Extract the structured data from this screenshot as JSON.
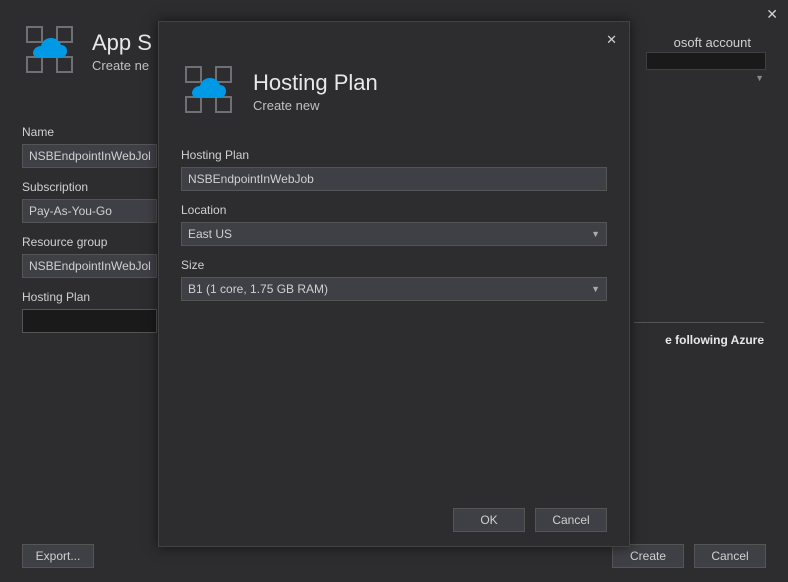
{
  "bg": {
    "title": "App S",
    "subtitle": "Create ne",
    "account_label": "osoft account",
    "fields": {
      "name_label": "Name",
      "name_value": "NSBEndpointInWebJob",
      "subscription_label": "Subscription",
      "subscription_value": "Pay-As-You-Go",
      "resource_group_label": "Resource group",
      "resource_group_value": "NSBEndpointInWebJob*",
      "hosting_plan_label": "Hosting Plan",
      "hosting_plan_value": ""
    },
    "right_text": "e following Azure",
    "export_button": "Export...",
    "create_button": "Create",
    "cancel_button": "Cancel"
  },
  "modal": {
    "title": "Hosting Plan",
    "subtitle": "Create new",
    "fields": {
      "hosting_plan_label": "Hosting Plan",
      "hosting_plan_value": "NSBEndpointInWebJob",
      "location_label": "Location",
      "location_value": "East US",
      "size_label": "Size",
      "size_value": "B1 (1 core, 1.75 GB RAM)"
    },
    "ok_button": "OK",
    "cancel_button": "Cancel"
  }
}
